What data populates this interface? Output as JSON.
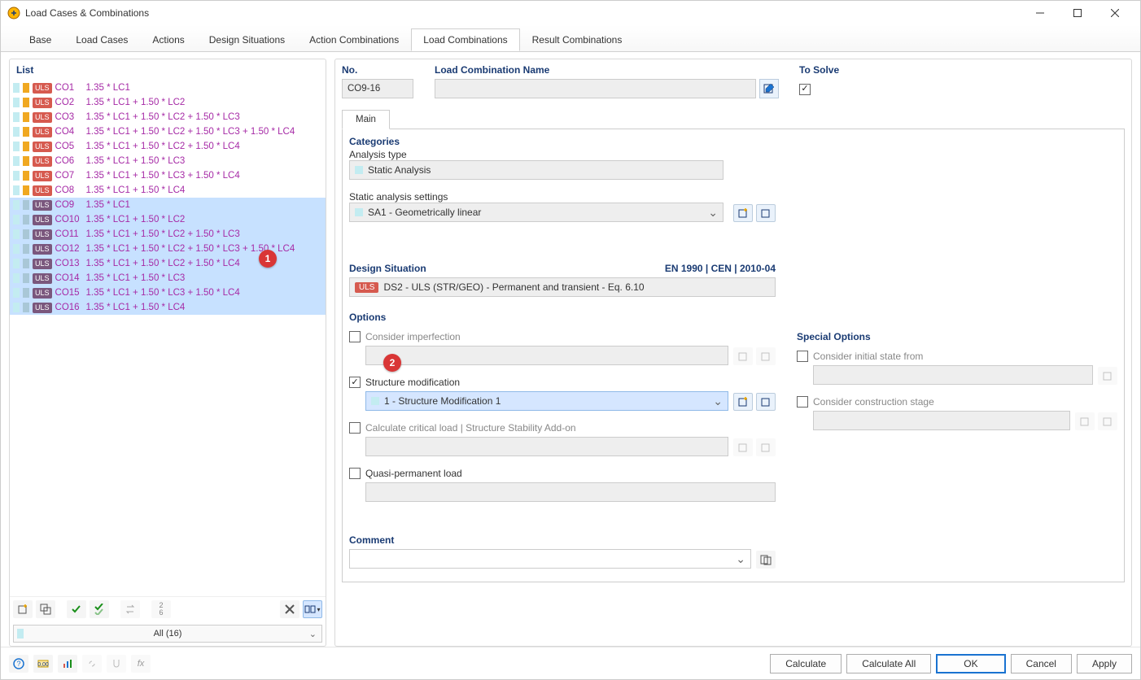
{
  "window": {
    "title": "Load Cases & Combinations"
  },
  "tabs": [
    "Base",
    "Load Cases",
    "Actions",
    "Design Situations",
    "Action Combinations",
    "Load Combinations",
    "Result Combinations"
  ],
  "tabs_selected_index": 5,
  "left": {
    "header": "List",
    "filter": "All (16)",
    "rows": [
      {
        "sel": false,
        "uls": "red",
        "id": "CO1",
        "f": "1.35 * LC1"
      },
      {
        "sel": false,
        "uls": "red",
        "id": "CO2",
        "f": "1.35 * LC1 + 1.50 * LC2"
      },
      {
        "sel": false,
        "uls": "red",
        "id": "CO3",
        "f": "1.35 * LC1 + 1.50 * LC2 + 1.50 * LC3"
      },
      {
        "sel": false,
        "uls": "red",
        "id": "CO4",
        "f": "1.35 * LC1 + 1.50 * LC2 + 1.50 * LC3 + 1.50 * LC4"
      },
      {
        "sel": false,
        "uls": "red",
        "id": "CO5",
        "f": "1.35 * LC1 + 1.50 * LC2 + 1.50 * LC4"
      },
      {
        "sel": false,
        "uls": "red",
        "id": "CO6",
        "f": "1.35 * LC1 + 1.50 * LC3"
      },
      {
        "sel": false,
        "uls": "red",
        "id": "CO7",
        "f": "1.35 * LC1 + 1.50 * LC3 + 1.50 * LC4"
      },
      {
        "sel": false,
        "uls": "red",
        "id": "CO8",
        "f": "1.35 * LC1 + 1.50 * LC4"
      },
      {
        "sel": true,
        "uls": "purple",
        "id": "CO9",
        "f": "1.35 * LC1"
      },
      {
        "sel": true,
        "uls": "purple",
        "id": "CO10",
        "f": "1.35 * LC1 + 1.50 * LC2"
      },
      {
        "sel": true,
        "uls": "purple",
        "id": "CO11",
        "f": "1.35 * LC1 + 1.50 * LC2 + 1.50 * LC3"
      },
      {
        "sel": true,
        "uls": "purple",
        "id": "CO12",
        "f": "1.35 * LC1 + 1.50 * LC2 + 1.50 * LC3 + 1.50 * LC4"
      },
      {
        "sel": true,
        "uls": "purple",
        "id": "CO13",
        "f": "1.35 * LC1 + 1.50 * LC2 + 1.50 * LC4"
      },
      {
        "sel": true,
        "uls": "purple",
        "id": "CO14",
        "f": "1.35 * LC1 + 1.50 * LC3"
      },
      {
        "sel": true,
        "uls": "purple",
        "id": "CO15",
        "f": "1.35 * LC1 + 1.50 * LC3 + 1.50 * LC4"
      },
      {
        "sel": true,
        "uls": "purple",
        "id": "CO16",
        "f": "1.35 * LC1 + 1.50 * LC4"
      }
    ]
  },
  "header_fields": {
    "no_label": "No.",
    "no_value": "CO9-16",
    "name_label": "Load Combination Name",
    "name_value": "",
    "to_solve_label": "To Solve",
    "to_solve_checked": true
  },
  "inner_tab": "Main",
  "categories": {
    "title": "Categories",
    "analysis_type_label": "Analysis type",
    "analysis_type_value": "Static Analysis",
    "sas_label": "Static analysis settings",
    "sas_value": "SA1 - Geometrically linear"
  },
  "design_situation": {
    "title": "Design Situation",
    "ref": "EN 1990 | CEN | 2010-04",
    "badge": "ULS",
    "value": "DS2 - ULS (STR/GEO) - Permanent and transient - Eq. 6.10"
  },
  "options": {
    "title": "Options",
    "imperfection_label": "Consider imperfection",
    "imperfection_checked": false,
    "struct_mod_label": "Structure modification",
    "struct_mod_checked": true,
    "struct_mod_value": "1 - Structure Modification 1",
    "critical_load_label": "Calculate critical load | Structure Stability Add-on",
    "critical_load_checked": false,
    "quasi_label": "Quasi-permanent load",
    "quasi_checked": false
  },
  "special_options": {
    "title": "Special Options",
    "initial_state_label": "Consider initial state from",
    "initial_state_checked": false,
    "construction_stage_label": "Consider construction stage",
    "construction_stage_checked": false
  },
  "comment": {
    "title": "Comment",
    "value": ""
  },
  "callouts": {
    "c1": "1",
    "c2": "2"
  },
  "footer": {
    "calculate": "Calculate",
    "calculate_all": "Calculate All",
    "ok": "OK",
    "cancel": "Cancel",
    "apply": "Apply"
  }
}
